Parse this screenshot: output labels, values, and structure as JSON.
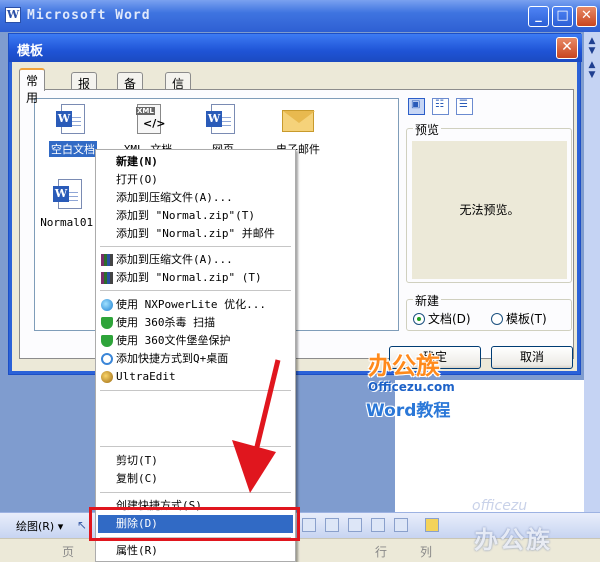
{
  "word_window": {
    "title": "Microsoft Word"
  },
  "dialog": {
    "title": "模板",
    "tabs": [
      "常用",
      "报告",
      "备忘录",
      "信函和传真"
    ],
    "templates": [
      {
        "label": "空白文档",
        "icon": "word-doc-icon"
      },
      {
        "label": "XML 文档",
        "icon": "xml-doc-icon"
      },
      {
        "label": "网页",
        "icon": "web-page-icon"
      },
      {
        "label": "电子邮件",
        "icon": "email-icon"
      },
      {
        "label": "Normal01.",
        "icon": "word-doc-icon"
      }
    ],
    "preview_label": "预览",
    "preview_message": "无法预览。",
    "new_group_label": "新建",
    "radio_document": "文档(D)",
    "radio_template": "模板(T)",
    "ok_label": "确定",
    "cancel_label": "取消"
  },
  "context_menu": {
    "items": [
      {
        "label": "新建(N)",
        "bold": true
      },
      {
        "label": "打开(O)"
      },
      {
        "label": "添加到压缩文件(A)..."
      },
      {
        "label": "添加到 \"Normal.zip\"(T)"
      },
      {
        "label": "添加到 \"Normal.zip\" 并邮件"
      },
      {
        "label": "添加到压缩文件(A)...",
        "icon": "winrar-icon"
      },
      {
        "label": "添加到 \"Normal.zip\" (T)",
        "icon": "winrar-icon"
      },
      {
        "label": "使用 NXPowerLite 优化...",
        "icon": "nxpowerlite-icon"
      },
      {
        "label": "使用 360杀毒 扫描",
        "icon": "360-shield-icon"
      },
      {
        "label": "使用 360文件堡垒保护",
        "icon": "360-shield-icon"
      },
      {
        "label": "添加快捷方式到Q+桌面",
        "icon": "qplus-icon"
      },
      {
        "label": "UltraEdit",
        "icon": "ultraedit-icon"
      },
      {
        "label": "剪切(T)"
      },
      {
        "label": "复制(C)"
      },
      {
        "label": "创建快捷方式(S)"
      },
      {
        "label": "删除(D)",
        "highlighted": true
      },
      {
        "label": "属性(R)"
      }
    ]
  },
  "drawing_toolbar": {
    "label": "绘图(R) ▾"
  },
  "status_bar": {
    "page": "页",
    "line": "行",
    "col": "列"
  },
  "watermark": {
    "brand": "办公族",
    "domain": "Officezu.com",
    "subtitle": "Word教程",
    "corner": "办公族",
    "corner_url": "officezu"
  },
  "colors": {
    "highlight": "#316ac5",
    "annotation": "#e0161e",
    "title_blue": "#1f54d6"
  }
}
